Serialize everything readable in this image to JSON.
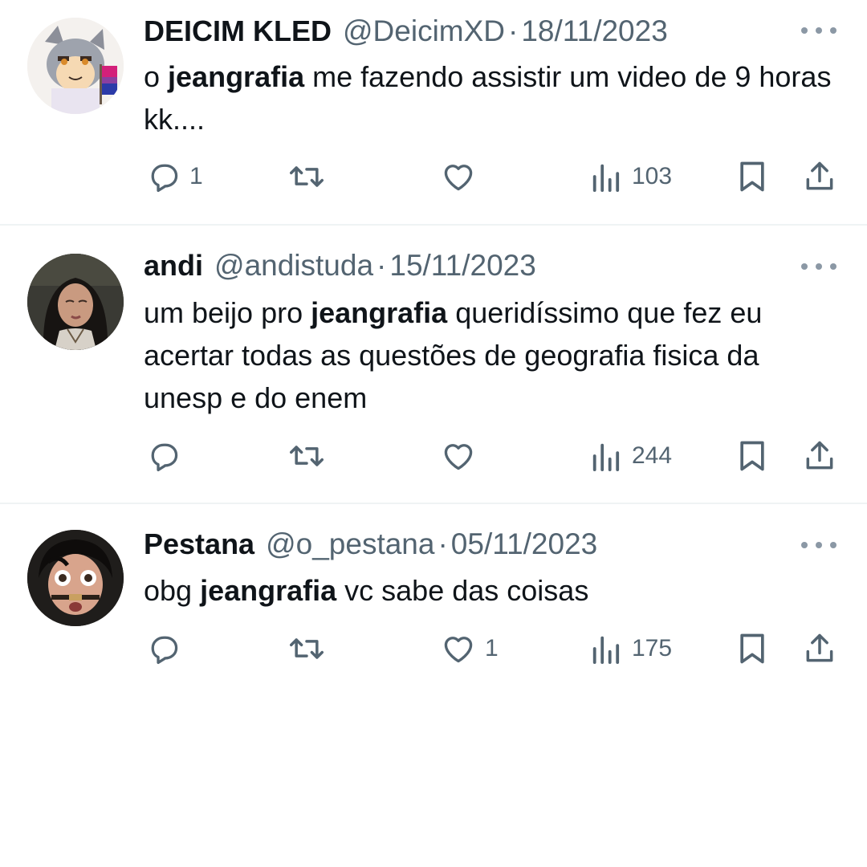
{
  "tweets": [
    {
      "name": "DEICIM KLED",
      "handle": "@DeicimXD",
      "separator": "·",
      "date": "18/11/2023",
      "text_before": "o ",
      "mention": "jeangrafia",
      "text_after": " me fazendo assistir um video de 9 horas kk....",
      "avatar": "furry-wolf-avatar",
      "replies": "1",
      "retweets": "",
      "likes": "",
      "views": "103"
    },
    {
      "name": "andi",
      "handle": "@andistuda",
      "separator": "·",
      "date": "15/11/2023",
      "text_before": "um beijo pro ",
      "mention": "jeangrafia",
      "text_after": " queridíssimo que fez eu acertar todas as questões de geografia fisica da unesp e do enem",
      "avatar": "girl-portrait-avatar",
      "replies": "",
      "retweets": "",
      "likes": "",
      "views": "244"
    },
    {
      "name": "Pestana",
      "handle": "@o_pestana",
      "separator": "·",
      "date": "05/11/2023",
      "text_before": "obg ",
      "mention": "jeangrafia",
      "text_after": " vc sabe das coisas",
      "avatar": "boy-face-avatar",
      "replies": "",
      "retweets": "",
      "likes": "1",
      "views": "175"
    }
  ],
  "icons": {
    "reply": "reply-icon",
    "retweet": "retweet-icon",
    "like": "heart-icon",
    "views": "views-icon",
    "bookmark": "bookmark-icon",
    "share": "share-icon",
    "more": "more-icon"
  },
  "colors": {
    "text": "#0f1419",
    "secondary": "#536471",
    "divider": "#eff3f4"
  }
}
